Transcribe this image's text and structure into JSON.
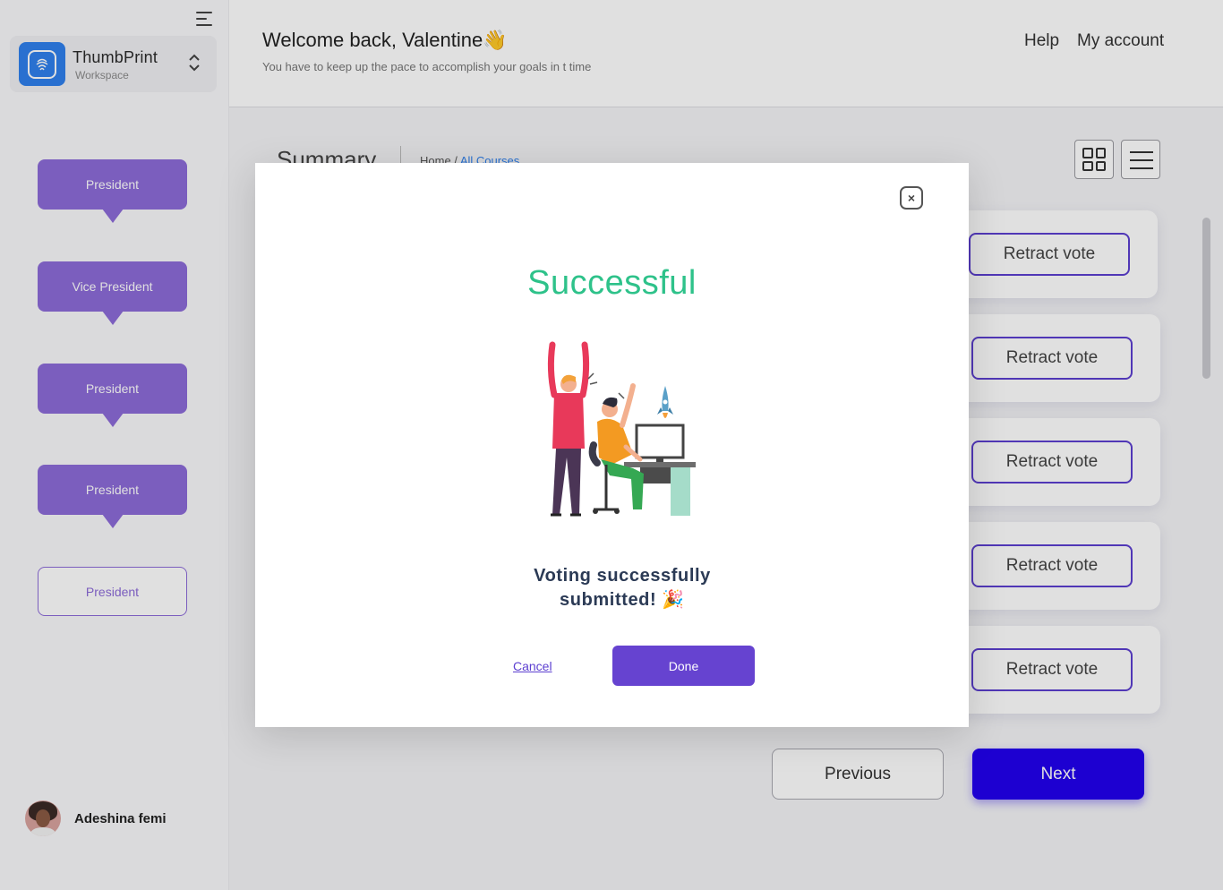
{
  "sidebar": {
    "workspace": {
      "name": "ThumbPrint",
      "sub": "Workspace"
    },
    "positions": [
      {
        "label": "President"
      },
      {
        "label": "Vice President"
      },
      {
        "label": "President"
      },
      {
        "label": "President"
      },
      {
        "label": "President"
      }
    ],
    "user": {
      "name": "Adeshina femi"
    }
  },
  "header": {
    "welcome": "Welcome back, Valentine👋",
    "subtitle": "You have to keep up the pace to accomplish your goals in t time",
    "help": "Help",
    "account": "My account"
  },
  "main": {
    "title": "Summary",
    "breadcrumb": {
      "home": "Home /",
      "current": "All Courses"
    },
    "retract_label": "Retract vote",
    "previous_label": "Previous",
    "next_label": "Next"
  },
  "modal": {
    "title": "Successful",
    "message_line1": "Voting successfully",
    "message_line2": "submitted! 🎉",
    "cancel_label": "Cancel",
    "done_label": "Done",
    "close_symbol": "×"
  },
  "colors": {
    "accent": "#6643d0",
    "success": "#2ec28a",
    "primary_button": "#2200ee",
    "position_bubble": "#8d6bd9"
  }
}
